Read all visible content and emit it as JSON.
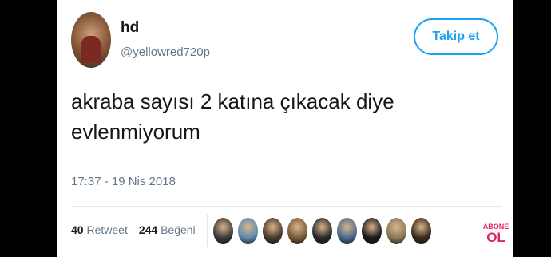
{
  "author": {
    "name": "hd",
    "handle": "@yellowred720p"
  },
  "follow_button": {
    "label": "Takip et"
  },
  "tweet": {
    "line1": "akraba sayısı 2 katına çıkacak diye",
    "line2": "evlenmiyorum",
    "timestamp": "17:37 - 19 Nis 2018"
  },
  "stats": {
    "retweets_count": "40",
    "retweets_label": "Retweet",
    "likes_count": "244",
    "likes_label": "Beğeni"
  },
  "likers": [
    {
      "color": "#3a3a3a"
    },
    {
      "color": "#5a8db0"
    },
    {
      "color": "#4a3a2a"
    },
    {
      "color": "#7a5a3a"
    },
    {
      "color": "#2a2a2a"
    },
    {
      "color": "#4a6a8a"
    },
    {
      "color": "#1a1a1a"
    },
    {
      "color": "#8a7a5a"
    },
    {
      "color": "#3a2a1a"
    }
  ],
  "watermark": {
    "top": "ABONE",
    "bottom": "OL",
    "color": "#e0245e"
  },
  "colors": {
    "accent": "#1da1f2",
    "text": "#14171a",
    "muted": "#657786"
  }
}
